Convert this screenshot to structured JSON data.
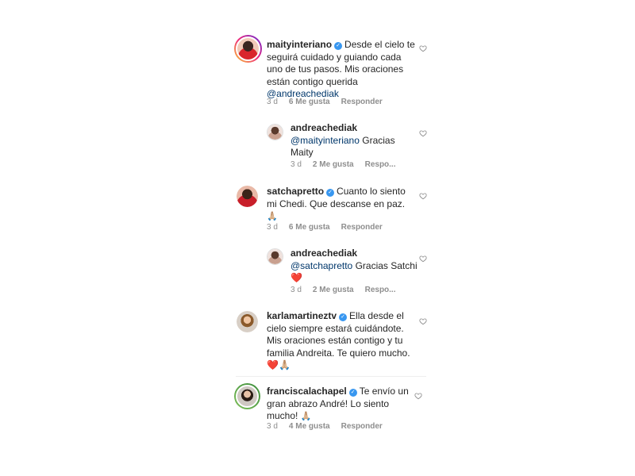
{
  "comments": [
    {
      "username": "maityinteriano",
      "verified": true,
      "text": "Desde el cielo te seguirá cuidado y guiando cada uno de tus pasos. Mis oraciones están contigo querida",
      "mention": "@andreachediak",
      "time": "3 d",
      "likes": "6 Me gusta",
      "reply": "Responder"
    },
    {
      "username": "andreachediak",
      "verified": false,
      "mention": "@maityinteriano",
      "text": "Gracias Maity",
      "time": "3 d",
      "likes": "2 Me gusta",
      "reply": "Respo..."
    },
    {
      "username": "satchapretto",
      "verified": true,
      "text": "Cuanto lo siento mi Chedi. Que descanse en paz.",
      "emoji": "🙏🏼",
      "time": "3 d",
      "likes": "6 Me gusta",
      "reply": "Responder"
    },
    {
      "username": "andreachediak",
      "verified": false,
      "mention": "@satchapretto",
      "text": "Gracias Satchi",
      "emoji": "❤️",
      "time": "3 d",
      "likes": "2 Me gusta",
      "reply": "Respo..."
    },
    {
      "username": "karlamartineztv",
      "verified": true,
      "text": "Ella desde el cielo siempre estará cuidándote. Mis oraciones están contigo y tu familia Andreita. Te quiero mucho.",
      "emoji": "❤️🙏🏼"
    },
    {
      "username": "franciscalachapel",
      "verified": true,
      "text": "Te envío un gran abrazo André! Lo siento mucho!",
      "emoji": "🙏🏼",
      "time": "3 d",
      "likes": "4 Me gusta",
      "reply": "Responder"
    }
  ],
  "icons": {
    "like": "heart-outline-icon",
    "verified": "verified-badge-icon"
  },
  "colors": {
    "text": "#262626",
    "meta": "#8e8e8e",
    "mention": "#00376b",
    "verified": "#3897f0",
    "heart_emoji": "#e0245e"
  }
}
